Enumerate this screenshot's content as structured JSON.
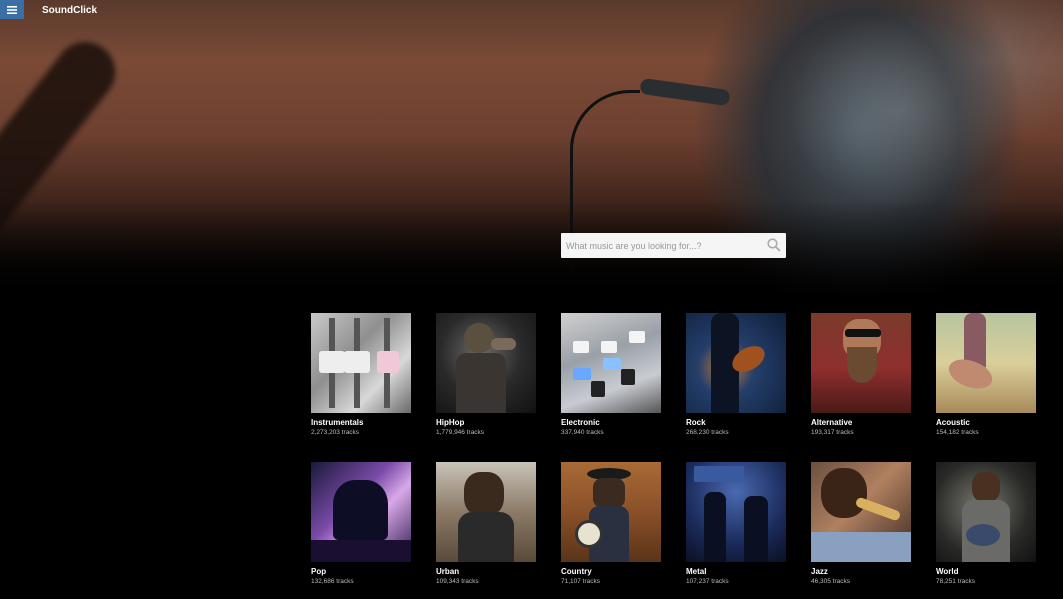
{
  "header": {
    "menu_icon": "hamburger-menu-icon",
    "brand": "SoundClick",
    "accent_color": "#3a6ea5"
  },
  "search": {
    "placeholder": "What music are you looking for...?",
    "value": "",
    "icon": "search-icon"
  },
  "genres": [
    {
      "name": "Instrumentals",
      "count": "2,273,203 tracks"
    },
    {
      "name": "HipHop",
      "count": "1,779,946 tracks"
    },
    {
      "name": "Electronic",
      "count": "337,940 tracks"
    },
    {
      "name": "Rock",
      "count": "268,230 tracks"
    },
    {
      "name": "Alternative",
      "count": "193,317 tracks"
    },
    {
      "name": "Acoustic",
      "count": "154,182 tracks"
    },
    {
      "name": "Pop",
      "count": "132,686 tracks"
    },
    {
      "name": "Urban",
      "count": "109,343 tracks"
    },
    {
      "name": "Country",
      "count": "71,107 tracks"
    },
    {
      "name": "Metal",
      "count": "107,237 tracks"
    },
    {
      "name": "Jazz",
      "count": "46,305 tracks"
    },
    {
      "name": "World",
      "count": "78,251 tracks"
    }
  ]
}
